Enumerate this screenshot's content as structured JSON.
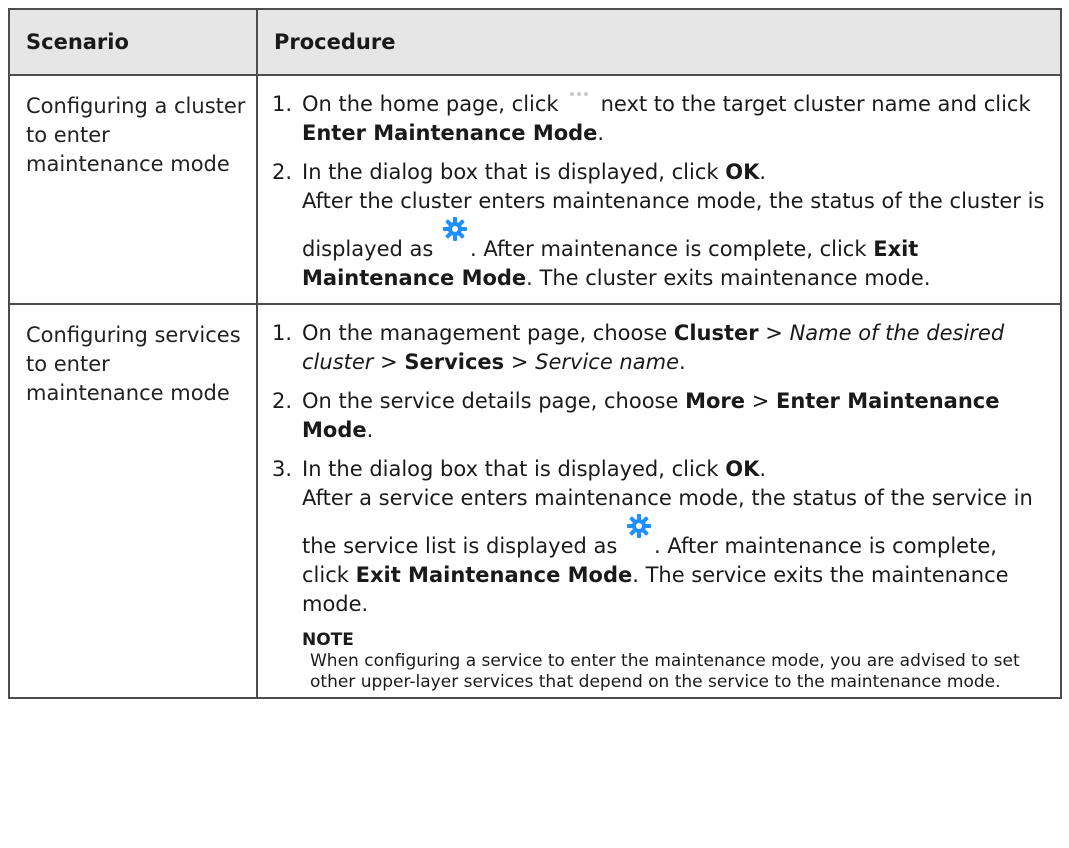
{
  "table": {
    "header": {
      "scenario": "Scenario",
      "procedure": "Procedure"
    },
    "row1": {
      "scenario": "Configuring a cluster to enter maintenance mode",
      "step1": {
        "num": "1.",
        "a": "On the home page, click",
        "b": "next to the target cluster name and click",
        "bold1": "Enter Maintenance Mode",
        "end": "."
      },
      "step2": {
        "num": "2.",
        "a": "In the dialog box that is displayed, click",
        "bold1": "OK",
        "end": ".",
        "r1": "After the cluster enters maintenance mode, the status of the cluster is displayed as",
        "r2": ". After maintenance is complete, click",
        "bold2": "Exit Maintenance Mode",
        "r3": ". The cluster exits maintenance mode."
      }
    },
    "row2": {
      "scenario": "Configuring services to enter maintenance mode",
      "step1": {
        "num": "1.",
        "a": "On the management page, choose",
        "bold1": "Cluster",
        "sep1": " > ",
        "ital1": "Name of the desired cluster",
        "sep2": " > ",
        "bold2": "Services",
        "sep3": " > ",
        "ital2": "Service name",
        "end": "."
      },
      "step2": {
        "num": "2.",
        "a": "On the service details page, choose",
        "bold1": "More",
        "sep": " > ",
        "bold2": "Enter Maintenance Mode",
        "end": "."
      },
      "step3": {
        "num": "3.",
        "a": "In the dialog box that is displayed, click",
        "bold1": "OK",
        "end": ".",
        "r1": "After a service enters maintenance mode, the status of the service in the service list is displayed as",
        "r2": ". After maintenance is complete, click",
        "bold2": "Exit Maintenance Mode",
        "r3": ". The service exits the maintenance mode."
      },
      "note": {
        "label": "NOTE",
        "text": "When configuring a service to enter the maintenance mode, you are advised to set other upper-layer services that depend on the service to the maintenance mode."
      }
    }
  },
  "icons": {
    "more": "more-dots-icon",
    "maintenance": "maintenance-gear-icon",
    "gear_color": "#1e90ff"
  }
}
